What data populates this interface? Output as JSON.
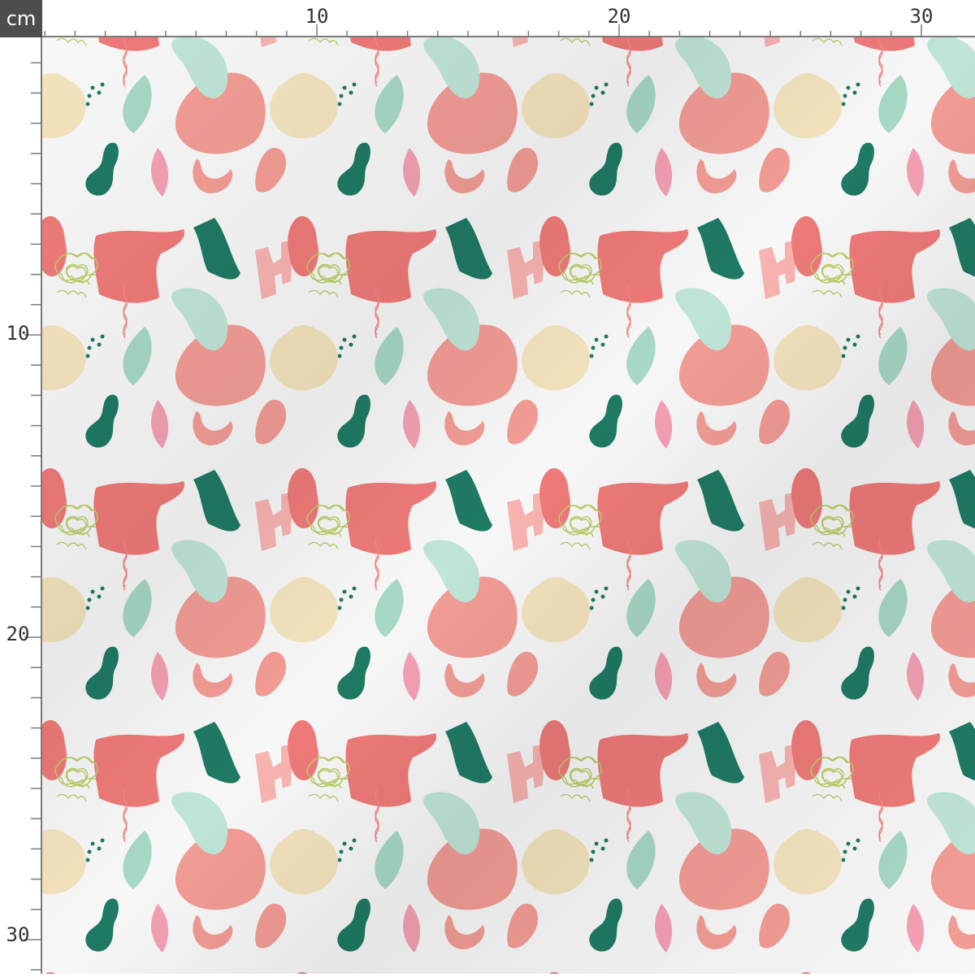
{
  "ruler": {
    "unit": "cm",
    "top_labels": [
      "10",
      "20",
      "30"
    ],
    "left_labels": [
      "10",
      "20",
      "30"
    ]
  },
  "pattern": {
    "background": "#f7f7f7",
    "colors": {
      "coral": "#ee7a78",
      "salmon": "#f29c95",
      "light_pink": "#f7b3b0",
      "pink": "#f4a0b4",
      "mint": "#a6d8c4",
      "light_mint": "#bfe5d6",
      "dark_green": "#1f7a63",
      "cream": "#f3e3bd",
      "lime_scribble": "#b9cf6a",
      "wavy_line": "#ee8a85"
    },
    "repeat_cm": 10
  }
}
